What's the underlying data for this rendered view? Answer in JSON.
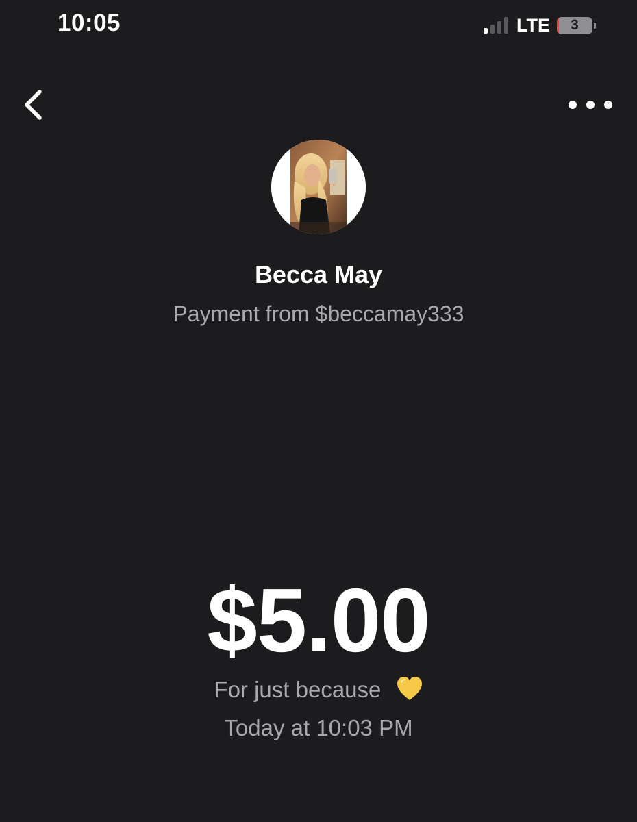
{
  "status_bar": {
    "time": "10:05",
    "network": "LTE",
    "battery_level": "3",
    "signal_bars_active": 1,
    "signal_bars_total": 4,
    "battery_fraction": 0.03
  },
  "nav": {
    "back_icon": "chevron-left-icon",
    "more_icon": "ellipsis-icon"
  },
  "payment": {
    "sender_name": "Becca May",
    "subtitle": "Payment from $beccamay333",
    "amount": "$5.00",
    "note": "For just because",
    "note_emoji": "yellow-heart-icon",
    "timestamp": "Today at 10:03 PM"
  },
  "colors": {
    "background": "#1c1c1e",
    "primary_text": "#ffffff",
    "secondary_text": "#a8a8ad",
    "heart": "#f7c948",
    "battery_low": "#ff3b30"
  }
}
